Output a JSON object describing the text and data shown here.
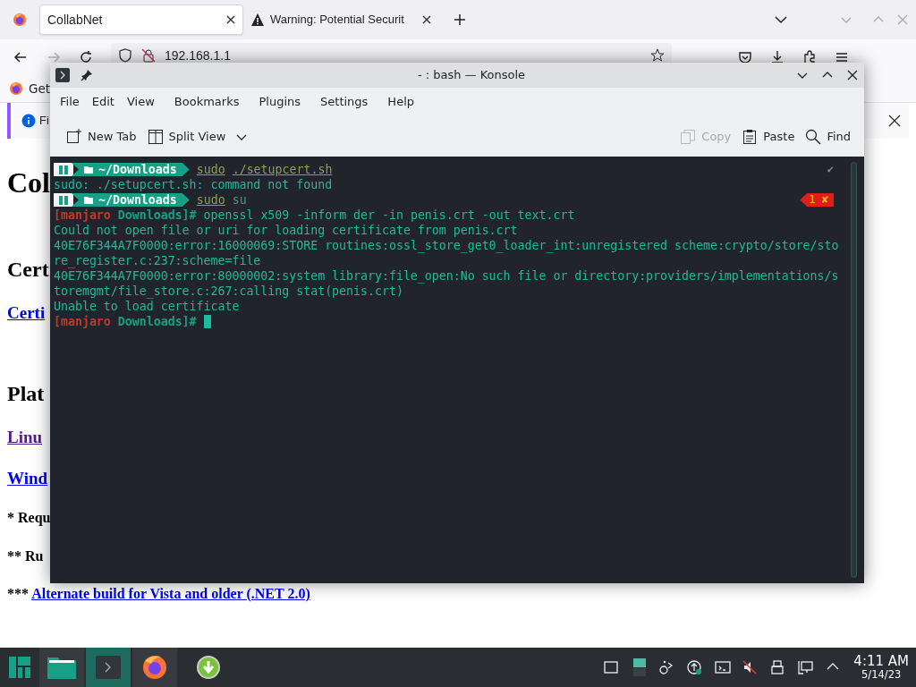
{
  "browser": {
    "tabs": [
      {
        "label": "CollabNet",
        "selected": true,
        "kind": "site"
      },
      {
        "label": "Warning: Potential Securit",
        "selected": false,
        "kind": "warning"
      }
    ],
    "address": "192.168.1.1",
    "bookmark": "Get",
    "notice": "Fi",
    "page": [
      {
        "kind": "title",
        "text": "Col"
      },
      {
        "kind": "heading",
        "text": "Cert"
      },
      {
        "kind": "link",
        "text": "Certi",
        "visited": false
      },
      {
        "kind": "heading",
        "text": "Plat"
      },
      {
        "kind": "link",
        "text": "Linu",
        "visited": true
      },
      {
        "kind": "link",
        "text": "Wind",
        "visited": false
      },
      {
        "kind": "note",
        "text": "* Requ"
      },
      {
        "kind": "note",
        "text": "** Ru"
      },
      {
        "kind": "note",
        "text": "***",
        "link": "Alternate build for Vista and older (.NET 2.0)"
      }
    ]
  },
  "konsole": {
    "title": "- : bash — Konsole",
    "menu": [
      "File",
      "Edit",
      "View",
      "Bookmarks",
      "Plugins",
      "Settings",
      "Help"
    ],
    "toolbar": [
      {
        "label": "New Tab",
        "kind": "newtab",
        "disabled": false
      },
      {
        "label": "Split View",
        "kind": "split",
        "disabled": false
      },
      {
        "label": "Copy",
        "kind": "copy",
        "disabled": true
      },
      {
        "label": "Paste",
        "kind": "paste",
        "disabled": false
      },
      {
        "label": "Find",
        "kind": "find",
        "disabled": false
      }
    ],
    "lines": [
      {
        "kind": "powerline",
        "path": "~/Downloads",
        "command": "sudo",
        "argument": "./setupcert.sh",
        "argument_exists": true,
        "status": "✔",
        "failed": false
      },
      {
        "kind": "output",
        "text": "sudo: ./setupcert.sh: command not found"
      },
      {
        "kind": "powerline",
        "path": "~/Downloads",
        "command": "sudo",
        "argument": "su",
        "argument_exists": false,
        "status": "1 ✘",
        "failed": true
      },
      {
        "kind": "root",
        "user": "[manjaro",
        "dir": "Downloads]#",
        "text": "openssl x509 -inform der -in penis.crt -out text.crt"
      },
      {
        "kind": "output",
        "text": "Could not open file or uri for loading certificate from penis.crt"
      },
      {
        "kind": "output",
        "text": "40E76F344A7F0000:error:16000069:STORE routines:ossl_store_get0_loader_int:unregistered scheme:crypto/store/sto"
      },
      {
        "kind": "output",
        "text": "re_register.c:237:scheme=file"
      },
      {
        "kind": "output",
        "text": "40E76F344A7F0000:error:80000002:system library:file_open:No such file or directory:providers/implementations/s"
      },
      {
        "kind": "output",
        "text": "toremgmt/file_store.c:267:calling stat(penis.crt)"
      },
      {
        "kind": "output",
        "text": "Unable to load certificate"
      },
      {
        "kind": "root",
        "user": "[manjaro",
        "dir": "Downloads]#",
        "cursor": true
      }
    ]
  },
  "taskbar": {
    "apps": [
      {
        "kind": "files",
        "active": false
      },
      {
        "kind": "terminal",
        "active": true
      },
      {
        "kind": "firefox",
        "active": false
      },
      {
        "kind": "update",
        "active": false
      }
    ],
    "time": "4:11 AM",
    "date": "5/14/23"
  }
}
